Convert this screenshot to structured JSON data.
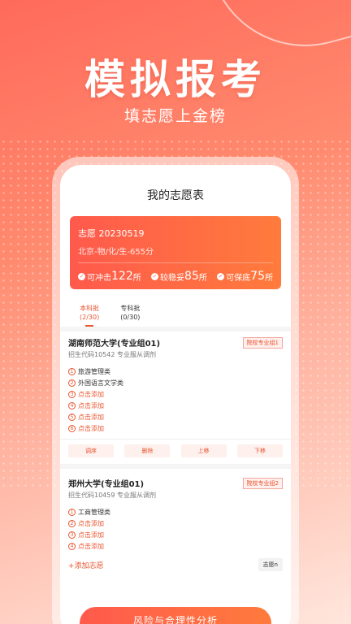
{
  "hero": {
    "title": "模拟报考",
    "subtitle": "填志愿上金榜"
  },
  "screen": {
    "title": "我的志愿表"
  },
  "card": {
    "name": "志愿 20230519",
    "info": "北京-物/化/生-655分",
    "stats": [
      {
        "label": "可冲击",
        "value": "122",
        "unit": "所"
      },
      {
        "label": "较稳妥",
        "value": "85",
        "unit": "所"
      },
      {
        "label": "可保底",
        "value": "75",
        "unit": "所"
      }
    ]
  },
  "tabs": [
    {
      "label": "本科批",
      "count": "(2/30)",
      "active": true
    },
    {
      "label": "专科批",
      "count": "(0/30)",
      "active": false
    }
  ],
  "schools": [
    {
      "name": "湖南师范大学(专业组01)",
      "code": "招生代码10542  专业服从调剂",
      "badge": "院校专业组1",
      "majors": [
        {
          "n": "1",
          "text": "旅游管理类"
        },
        {
          "n": "2",
          "text": "外国语言文学类"
        },
        {
          "n": "3",
          "text": "点击添加"
        },
        {
          "n": "4",
          "text": "点击添加"
        },
        {
          "n": "5",
          "text": "点击添加"
        },
        {
          "n": "6",
          "text": "点击添加"
        }
      ],
      "buttons": [
        "调序",
        "删除",
        "上移",
        "下移"
      ]
    },
    {
      "name": "郑州大学(专业组01)",
      "code": "招生代码10459  专业服从调剂",
      "badge": "院校专业组2",
      "majors": [
        {
          "n": "1",
          "text": "工商管理类"
        },
        {
          "n": "2",
          "text": "点击添加"
        },
        {
          "n": "3",
          "text": "点击添加"
        },
        {
          "n": "4",
          "text": "点击添加"
        }
      ]
    }
  ],
  "add_link": "+添加志愿",
  "volunteer_btn": "志愿n",
  "bottom_button": "风险与合理性分析",
  "icons": {
    "check": "check-circle-icon"
  },
  "colors": {
    "accent": "#e9542f",
    "gradient_start": "#ff5a4c",
    "gradient_end": "#ff7b3c"
  }
}
